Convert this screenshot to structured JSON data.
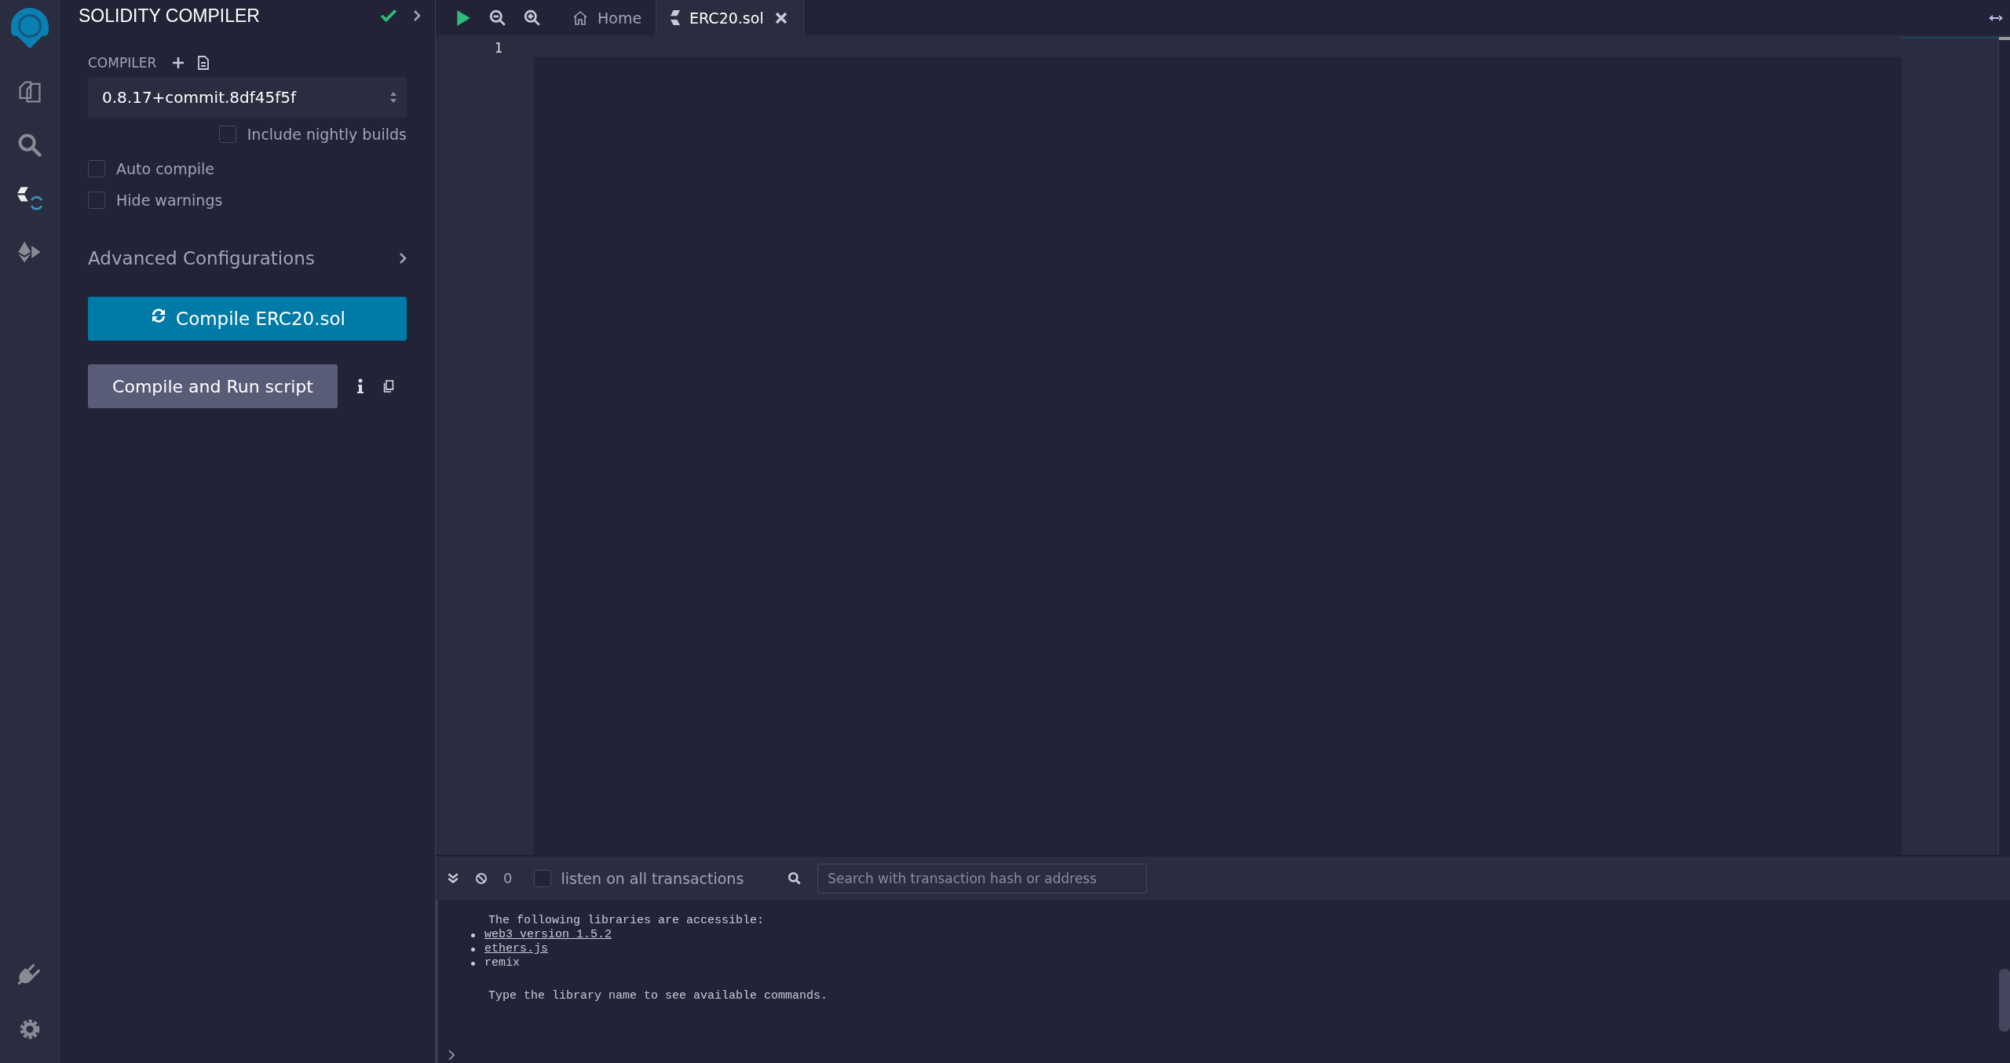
{
  "panel": {
    "title": "SOLIDITY COMPILER",
    "compiler_label": "COMPILER",
    "compiler_version": "0.8.17+commit.8df45f5f",
    "options": [
      {
        "kind": "nightly",
        "label": "Include nightly builds",
        "checked": false
      },
      {
        "kind": "plain",
        "label": "Auto compile",
        "checked": false
      },
      {
        "kind": "plain",
        "label": "Hide warnings",
        "checked": false
      }
    ],
    "advanced": {
      "label": "Advanced Configurations",
      "expanded": false
    },
    "compile_button": "Compile ERC20.sol",
    "run_button": "Compile and Run script"
  },
  "tabs": [
    {
      "kind": "home",
      "label": "Home",
      "selected": false
    },
    {
      "kind": "file",
      "label": "ERC20.sol",
      "selected": true
    }
  ],
  "editor": {
    "line_numbers": [
      "1"
    ]
  },
  "terminal": {
    "pending_count": "0",
    "listen": {
      "label": "listen on all transactions",
      "checked": false
    },
    "search": {
      "placeholder": "Search with transaction hash or address"
    },
    "intro": "The following libraries are accessible:",
    "libraries": [
      {
        "text": "web3 version 1.5.2",
        "link": true
      },
      {
        "text": "ethers.js",
        "link": true
      },
      {
        "text": "remix",
        "link": false
      }
    ],
    "hint": "Type the library name to see available commands."
  }
}
